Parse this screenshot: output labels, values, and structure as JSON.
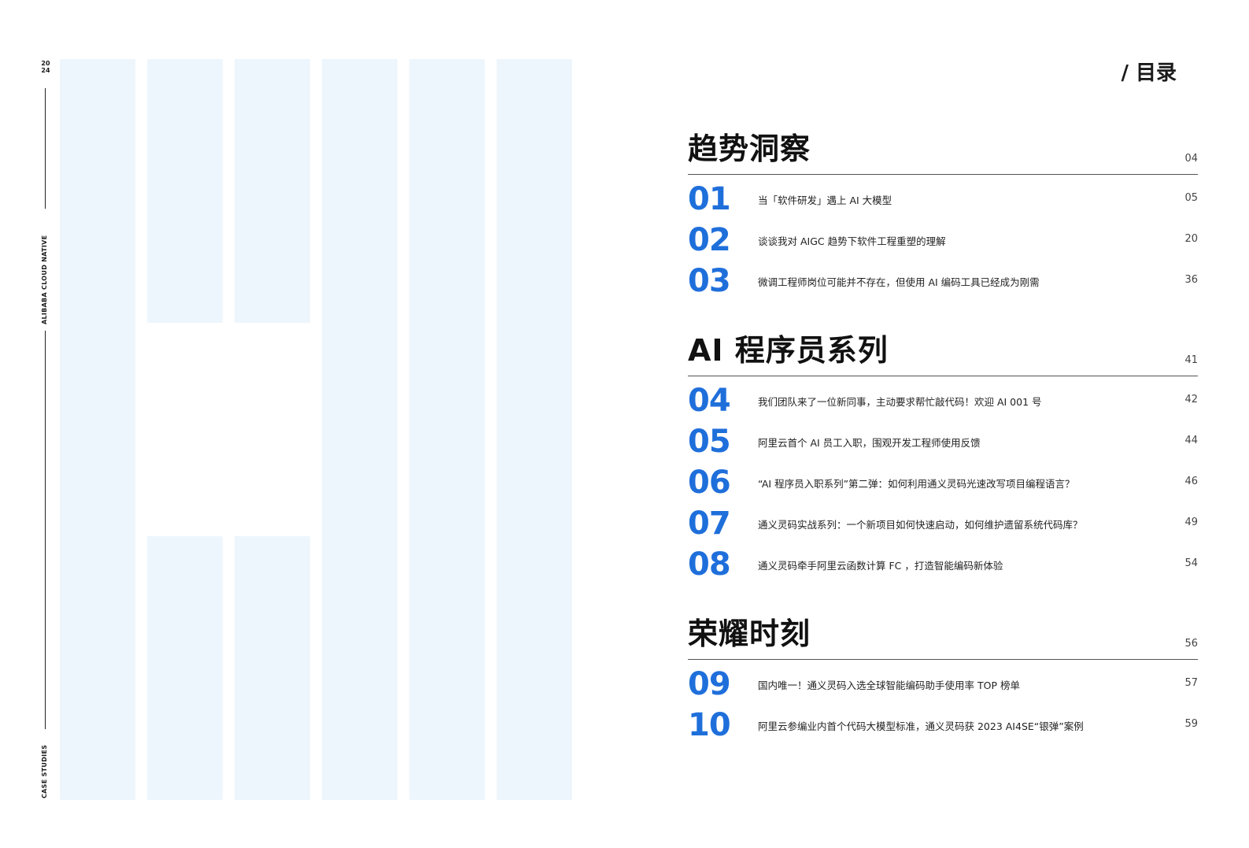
{
  "sidebar": {
    "year_top": "20",
    "year_bottom": "24",
    "label_top": "ALIBABA CLOUD  NATIVE",
    "label_bottom": "CASE STUDIES"
  },
  "toc": {
    "title": "/ 目录",
    "sections": [
      {
        "title": "趋势洞察",
        "page": "04",
        "entries": [
          {
            "num": "01",
            "text": "当「软件研发」遇上 AI 大模型",
            "page": "05"
          },
          {
            "num": "02",
            "text": "谈谈我对 AIGC 趋势下软件工程重塑的理解",
            "page": "20"
          },
          {
            "num": "03",
            "text": "微调工程师岗位可能并不存在，但使用 AI 编码工具已经成为刚需",
            "page": "36"
          }
        ]
      },
      {
        "title": "AI 程序员系列",
        "page": "41",
        "entries": [
          {
            "num": "04",
            "text": "我们团队来了一位新同事，主动要求帮忙敲代码！欢迎 AI 001 号",
            "page": "42"
          },
          {
            "num": "05",
            "text": "阿里云首个 AI 员工入职，围观开发工程师使用反馈",
            "page": "44"
          },
          {
            "num": "06",
            "text": "“AI 程序员入职系列”第二弹：如何利用通义灵码光速改写项目编程语言？",
            "page": "46"
          },
          {
            "num": "07",
            "text": "通义灵码实战系列：一个新项目如何快速启动，如何维护遗留系统代码库？",
            "page": "49"
          },
          {
            "num": "08",
            "text": "通义灵码牵手阿里云函数计算 FC ，打造智能编码新体验",
            "page": "54"
          }
        ]
      },
      {
        "title": "荣耀时刻",
        "page": "56",
        "entries": [
          {
            "num": "09",
            "text": "国内唯一！通义灵码入选全球智能编码助手使用率 TOP 榜单",
            "page": "57"
          },
          {
            "num": "10",
            "text": "阿里云参编业内首个代码大模型标准，通义灵码获 2023 AI4SE“银弹”案例",
            "page": "59"
          }
        ]
      }
    ]
  },
  "colors": {
    "accent": "#1f6fdb",
    "panel": "#eef6fd"
  }
}
